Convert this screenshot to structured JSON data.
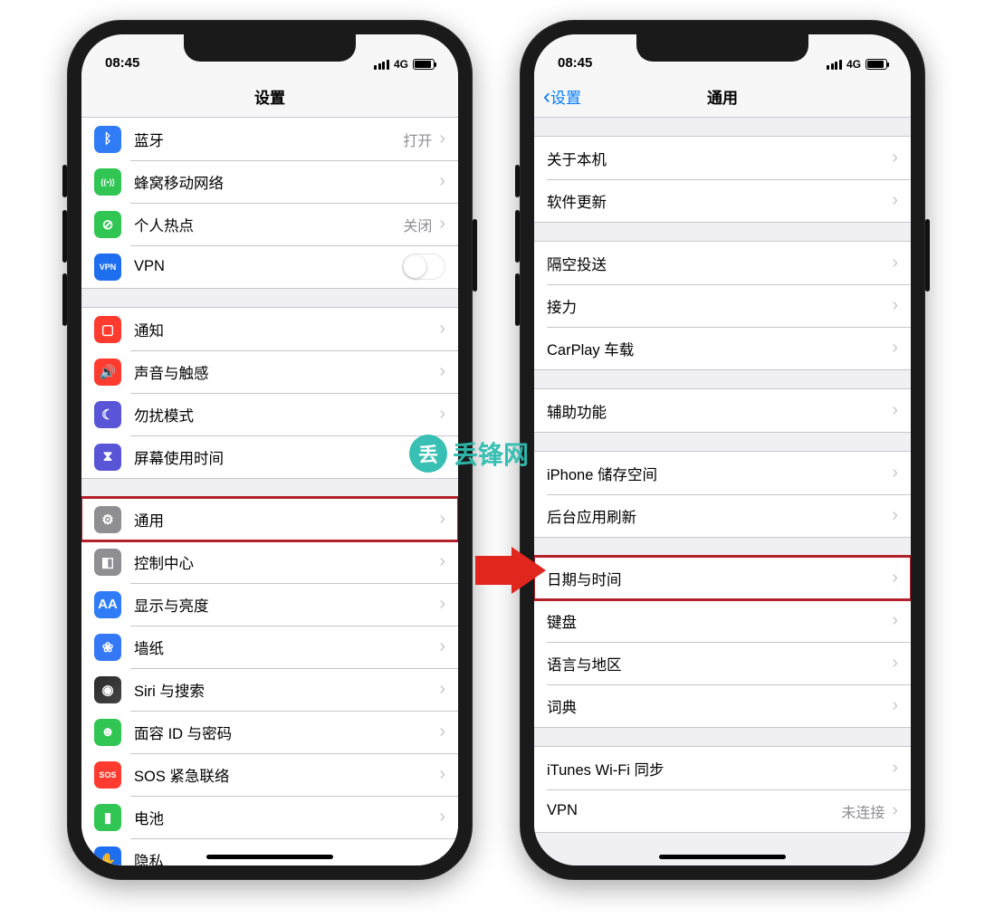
{
  "watermark": "丢锋网",
  "statusbar": {
    "time": "08:45",
    "network": "4G"
  },
  "left": {
    "title": "设置",
    "groups": [
      [
        {
          "icon": "bluetooth-icon",
          "label": "蓝牙",
          "value": "打开",
          "chevron": true,
          "color": "ic-blue",
          "glyph": "ᛒ"
        },
        {
          "icon": "cellular-icon",
          "label": "蜂窝移动网络",
          "chevron": true,
          "color": "ic-green",
          "glyph": "((•))"
        },
        {
          "icon": "hotspot-icon",
          "label": "个人热点",
          "value": "关闭",
          "chevron": true,
          "color": "ic-green",
          "glyph": "⊘"
        },
        {
          "icon": "vpn-icon",
          "label": "VPN",
          "toggle": true,
          "color": "ic-bluedeep",
          "glyph": "VPN"
        }
      ],
      [
        {
          "icon": "notifications-icon",
          "label": "通知",
          "chevron": true,
          "color": "ic-red",
          "glyph": "▢"
        },
        {
          "icon": "sounds-icon",
          "label": "声音与触感",
          "chevron": true,
          "color": "ic-red",
          "glyph": "🔊"
        },
        {
          "icon": "dnd-icon",
          "label": "勿扰模式",
          "chevron": true,
          "color": "ic-purple",
          "glyph": "☾"
        },
        {
          "icon": "screentime-icon",
          "label": "屏幕使用时间",
          "chevron": true,
          "color": "ic-purple",
          "glyph": "⧗"
        }
      ],
      [
        {
          "icon": "general-icon",
          "label": "通用",
          "chevron": true,
          "color": "ic-gray",
          "glyph": "⚙",
          "highlight": true
        },
        {
          "icon": "controlcenter-icon",
          "label": "控制中心",
          "chevron": true,
          "color": "ic-gray",
          "glyph": "◧"
        },
        {
          "icon": "display-icon",
          "label": "显示与亮度",
          "chevron": true,
          "color": "ic-bluetxt",
          "glyph": "AA"
        },
        {
          "icon": "wallpaper-icon",
          "label": "墙纸",
          "chevron": true,
          "color": "ic-bluelite",
          "glyph": "❀"
        },
        {
          "icon": "siri-icon",
          "label": "Siri 与搜索",
          "chevron": true,
          "color": "ic-siri",
          "glyph": "◉"
        },
        {
          "icon": "faceid-icon",
          "label": "面容 ID 与密码",
          "chevron": true,
          "color": "ic-green",
          "glyph": "☻"
        },
        {
          "icon": "sos-icon",
          "label": "SOS 紧急联络",
          "chevron": true,
          "color": "ic-sos",
          "glyph": "SOS"
        },
        {
          "icon": "battery-icon",
          "label": "电池",
          "chevron": true,
          "color": "ic-green",
          "glyph": "▮"
        },
        {
          "icon": "privacy-icon",
          "label": "隐私",
          "chevron": true,
          "color": "ic-bluedeep",
          "glyph": "✋"
        }
      ]
    ]
  },
  "right": {
    "back": "设置",
    "title": "通用",
    "groups": [
      [
        {
          "label": "关于本机",
          "chevron": true
        },
        {
          "label": "软件更新",
          "chevron": true
        }
      ],
      [
        {
          "label": "隔空投送",
          "chevron": true
        },
        {
          "label": "接力",
          "chevron": true
        },
        {
          "label": "CarPlay 车载",
          "chevron": true
        }
      ],
      [
        {
          "label": "辅助功能",
          "chevron": true
        }
      ],
      [
        {
          "label": "iPhone 储存空间",
          "chevron": true
        },
        {
          "label": "后台应用刷新",
          "chevron": true
        }
      ],
      [
        {
          "label": "日期与时间",
          "chevron": true,
          "highlight": true
        },
        {
          "label": "键盘",
          "chevron": true
        },
        {
          "label": "语言与地区",
          "chevron": true
        },
        {
          "label": "词典",
          "chevron": true
        }
      ],
      [
        {
          "label": "iTunes Wi-Fi 同步",
          "chevron": true
        },
        {
          "label": "VPN",
          "value": "未连接",
          "chevron": true
        }
      ]
    ]
  }
}
